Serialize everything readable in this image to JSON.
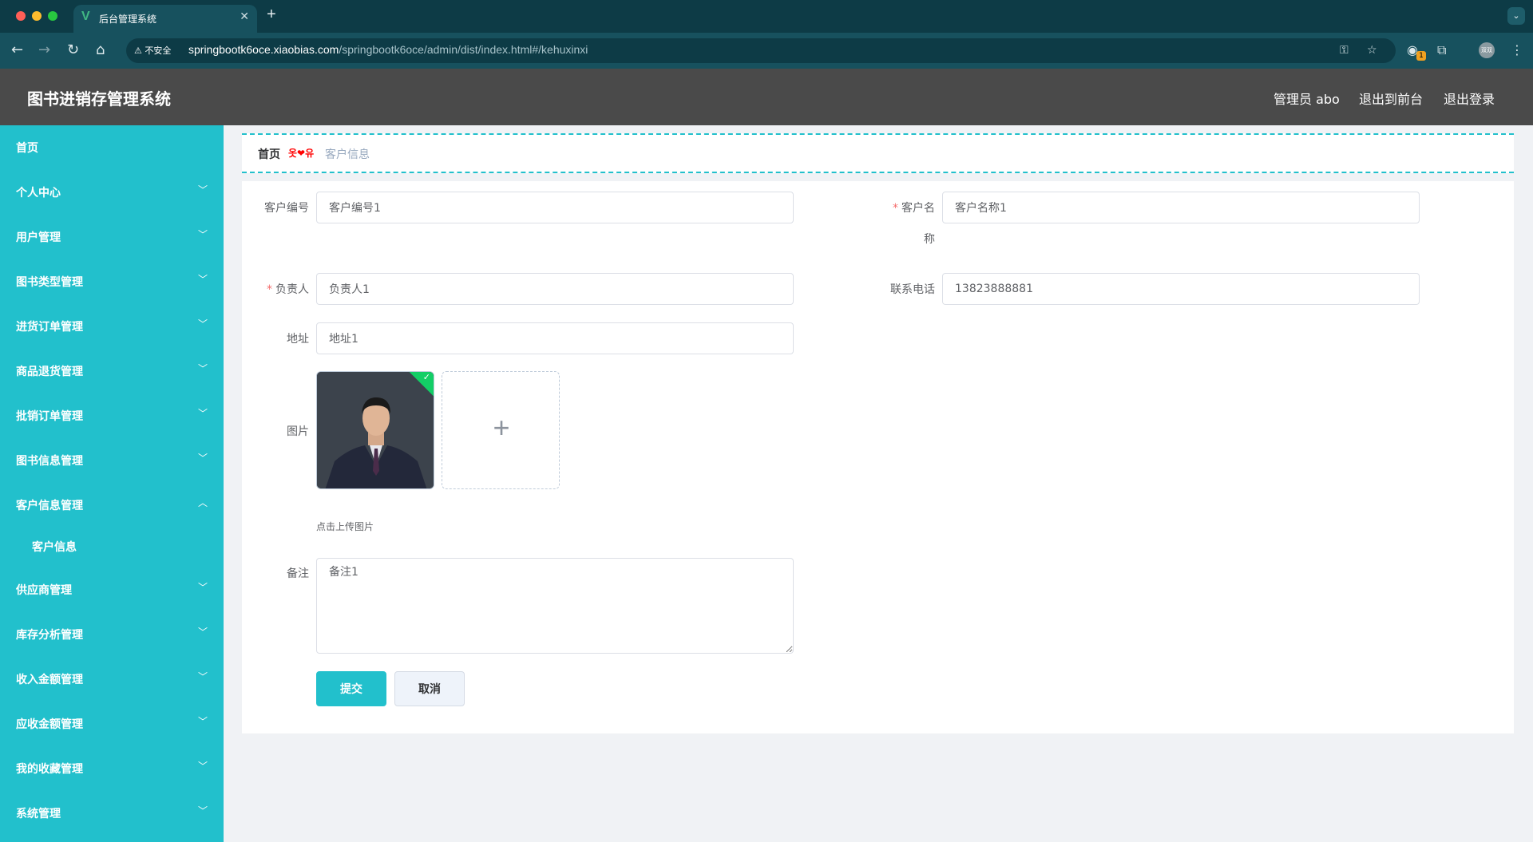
{
  "browser": {
    "tab_title": "后台管理系统",
    "tab_logo": "V",
    "insecure_label": "不安全",
    "url_host": "springbootk6oce.xiaobias.com",
    "url_path": "/springbootk6oce/admin/dist/index.html#/kehuxinxi",
    "extension_badge": "1",
    "profile_label": "双双"
  },
  "header": {
    "title": "图书进销存管理系统",
    "user_label": "管理员 abo",
    "to_frontend": "退出到前台",
    "logout": "退出登录"
  },
  "sidebar": {
    "items": [
      {
        "label": "首页"
      },
      {
        "label": "个人中心"
      },
      {
        "label": "用户管理"
      },
      {
        "label": "图书类型管理"
      },
      {
        "label": "进货订单管理"
      },
      {
        "label": "商品退货管理"
      },
      {
        "label": "批销订单管理"
      },
      {
        "label": "图书信息管理"
      },
      {
        "label": "客户信息管理"
      },
      {
        "label": "客户信息"
      },
      {
        "label": "供应商管理"
      },
      {
        "label": "库存分析管理"
      },
      {
        "label": "收入金额管理"
      },
      {
        "label": "应收金额管理"
      },
      {
        "label": "我的收藏管理"
      },
      {
        "label": "系统管理"
      }
    ]
  },
  "breadcrumb": {
    "home": "首页",
    "separator": "옷❤유",
    "current": "客户信息"
  },
  "form": {
    "customer_no_label": "客户编号",
    "customer_no_value": "客户编号1",
    "customer_name_label_1": "客户名",
    "customer_name_label_2": "称",
    "customer_name_value": "客户名称1",
    "owner_label": "负责人",
    "owner_value": "负责人1",
    "phone_label": "联系电话",
    "phone_value": "13823888881",
    "address_label": "地址",
    "address_value": "地址1",
    "image_label": "图片",
    "upload_tip": "点击上传图片",
    "remark_label": "备注",
    "remark_value": "备注1",
    "required_mark": "*",
    "submit": "提交",
    "cancel": "取消"
  },
  "colors": {
    "accent": "#22c0cc",
    "header_bg": "#4a4a4a",
    "required": "#f56c6c",
    "success": "#13ce66"
  }
}
